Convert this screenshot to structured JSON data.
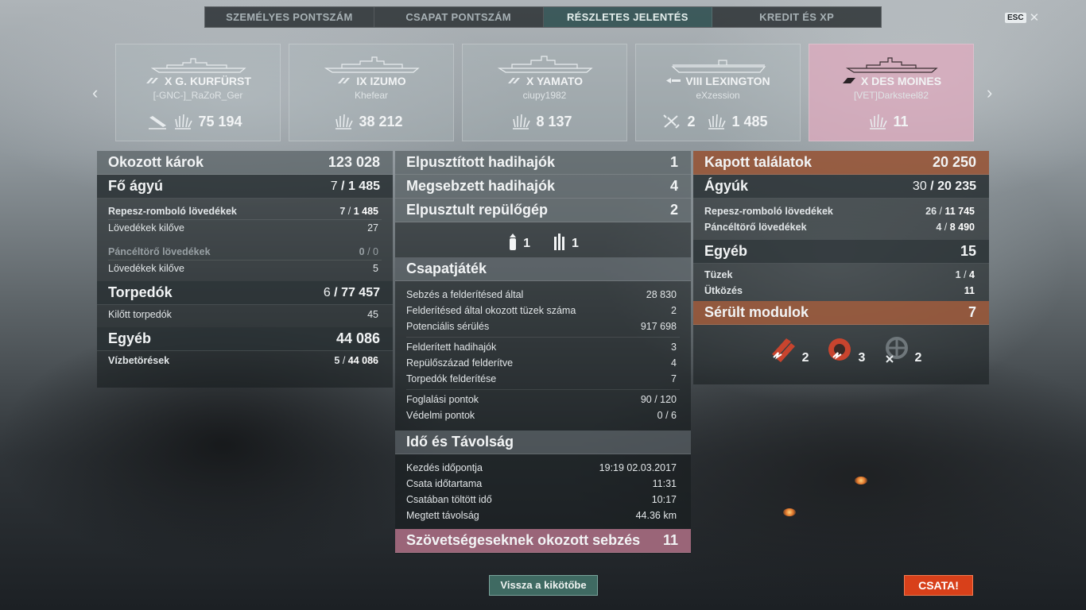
{
  "tabs": [
    {
      "label": "SZEMÉLYES PONTSZÁM"
    },
    {
      "label": "CSAPAT PONTSZÁM"
    },
    {
      "label": "RÉSZLETES JELENTÉS"
    },
    {
      "label": "KREDIT ÉS XP"
    }
  ],
  "esc": {
    "key": "ESC",
    "close": "✕"
  },
  "nav": {
    "left": "‹",
    "right": "›"
  },
  "ships": [
    {
      "name": "X G. KURFÜRST",
      "player": "[-GNC-]_RaZoR_Ger",
      "kills_icon": "sunk-ship-icon",
      "damage": "75 194"
    },
    {
      "name": "IX IZUMO",
      "player": "Khefear",
      "damage": "38 212"
    },
    {
      "name": "X YAMATO",
      "player": "ciupy1982",
      "damage": "8 137"
    },
    {
      "name": "VIII LEXINGTON",
      "player": "eXzession",
      "planes": "2",
      "damage": "1 485"
    },
    {
      "name": "X DES MOINES",
      "player": "[VET]Darksteel82",
      "damage": "11"
    }
  ],
  "damage": {
    "title": "Okozott károk",
    "total": "123 028",
    "main": {
      "label": "Fő ágyú",
      "hits": "7",
      "value": "1 485"
    },
    "he": {
      "label": "Repesz-romboló lövedékek",
      "hits": "7",
      "value": "1 485"
    },
    "he_fired": {
      "label": "Lövedékek kilőve",
      "value": "27"
    },
    "ap": {
      "label": "Páncéltörő lövedékek",
      "hits": "0",
      "value": "0"
    },
    "ap_fired": {
      "label": "Lövedékek kilőve",
      "value": "5"
    },
    "torp": {
      "label": "Torpedók",
      "hits": "6",
      "value": "77 457"
    },
    "torp_fired": {
      "label": "Kilőtt torpedók",
      "value": "45"
    },
    "other": {
      "label": "Egyéb",
      "value": "44 086"
    },
    "flood": {
      "label": "Vízbetörések",
      "hits": "5",
      "value": "44 086"
    }
  },
  "kills": {
    "destroyed": {
      "label": "Elpusztított hadihajók",
      "value": "1"
    },
    "damaged": {
      "label": "Megsebzett hadihajók",
      "value": "4"
    },
    "planes": {
      "label": "Elpusztult repülőgép",
      "value": "2"
    },
    "plane_icons": [
      {
        "icon": "fighter-plane-icon",
        "value": "1"
      },
      {
        "icon": "bomber-plane-icon",
        "value": "1"
      }
    ]
  },
  "team": {
    "title": "Csapatjáték",
    "rows1": [
      {
        "label": "Sebzés a felderítésed által",
        "value": "28 830"
      },
      {
        "label": "Felderítésed által okozott tüzek száma",
        "value": "2"
      },
      {
        "label": "Potenciális sérülés",
        "value": "917 698"
      }
    ],
    "rows2": [
      {
        "label": "Felderített hadihajók",
        "value": "3"
      },
      {
        "label": "Repülőszázad felderítve",
        "value": "4"
      },
      {
        "label": "Torpedók felderítése",
        "value": "7"
      }
    ],
    "rows3": [
      {
        "label": "Foglalási pontok",
        "value": "90 / 120"
      },
      {
        "label": "Védelmi pontok",
        "value": "0 / 6"
      }
    ]
  },
  "time": {
    "title": "Idő és Távolság",
    "rows": [
      {
        "label": "Kezdés időpontja",
        "value": "19:19  02.03.2017"
      },
      {
        "label": "Csata időtartama",
        "value": "11:31"
      },
      {
        "label": "Csatában töltött idő",
        "value": "10:17"
      },
      {
        "label": "Megtett távolság",
        "value": "44.36 km"
      }
    ]
  },
  "allies": {
    "label": "Szövetségeseknek okozott sebzés",
    "value": "11"
  },
  "received": {
    "title": "Kapott találatok",
    "total": "20 250",
    "guns": {
      "label": "Ágyúk",
      "hits": "30",
      "value": "20 235"
    },
    "he": {
      "label": "Repesz-romboló lövedékek",
      "hits": "26",
      "value": "11 745"
    },
    "ap": {
      "label": "Páncéltörő lövedékek",
      "hits": "4",
      "value": "8 490"
    },
    "other": {
      "label": "Egyéb",
      "value": "15"
    },
    "fires": {
      "label": "Tüzek",
      "hits": "1",
      "value": "4"
    },
    "ram": {
      "label": "Ütközés",
      "value": "11"
    }
  },
  "modules": {
    "title": "Sérült modulok",
    "total": "7",
    "items": [
      {
        "icon": "torpedo-tubes-icon",
        "value": "2"
      },
      {
        "icon": "engine-icon",
        "value": "3"
      },
      {
        "icon": "steering-gear-icon",
        "value": "2"
      }
    ]
  },
  "buttons": {
    "back": "Vissza a kikötőbe",
    "battle": "CSATA!"
  }
}
